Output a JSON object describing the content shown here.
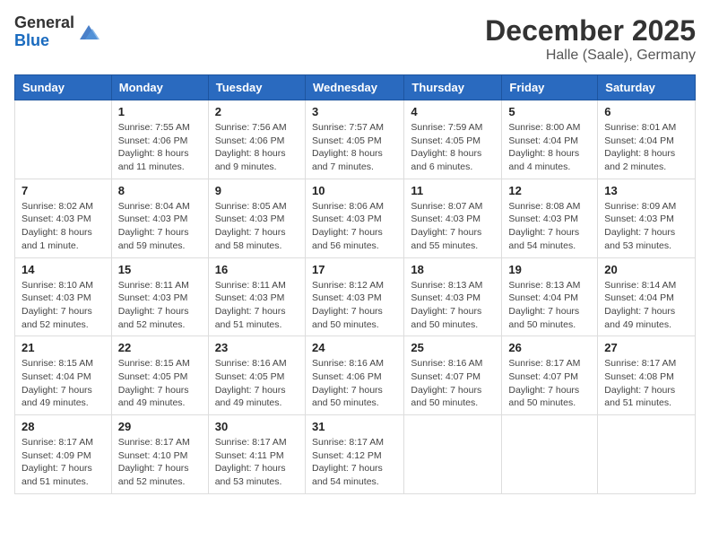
{
  "header": {
    "logo_general": "General",
    "logo_blue": "Blue",
    "month": "December 2025",
    "location": "Halle (Saale), Germany"
  },
  "columns": [
    "Sunday",
    "Monday",
    "Tuesday",
    "Wednesday",
    "Thursday",
    "Friday",
    "Saturday"
  ],
  "weeks": [
    [
      {
        "day": "",
        "sunrise": "",
        "sunset": "",
        "daylight": ""
      },
      {
        "day": "1",
        "sunrise": "7:55 AM",
        "sunset": "4:06 PM",
        "daylight": "8 hours and 11 minutes."
      },
      {
        "day": "2",
        "sunrise": "7:56 AM",
        "sunset": "4:06 PM",
        "daylight": "8 hours and 9 minutes."
      },
      {
        "day": "3",
        "sunrise": "7:57 AM",
        "sunset": "4:05 PM",
        "daylight": "8 hours and 7 minutes."
      },
      {
        "day": "4",
        "sunrise": "7:59 AM",
        "sunset": "4:05 PM",
        "daylight": "8 hours and 6 minutes."
      },
      {
        "day": "5",
        "sunrise": "8:00 AM",
        "sunset": "4:04 PM",
        "daylight": "8 hours and 4 minutes."
      },
      {
        "day": "6",
        "sunrise": "8:01 AM",
        "sunset": "4:04 PM",
        "daylight": "8 hours and 2 minutes."
      }
    ],
    [
      {
        "day": "7",
        "sunrise": "8:02 AM",
        "sunset": "4:03 PM",
        "daylight": "8 hours and 1 minute."
      },
      {
        "day": "8",
        "sunrise": "8:04 AM",
        "sunset": "4:03 PM",
        "daylight": "7 hours and 59 minutes."
      },
      {
        "day": "9",
        "sunrise": "8:05 AM",
        "sunset": "4:03 PM",
        "daylight": "7 hours and 58 minutes."
      },
      {
        "day": "10",
        "sunrise": "8:06 AM",
        "sunset": "4:03 PM",
        "daylight": "7 hours and 56 minutes."
      },
      {
        "day": "11",
        "sunrise": "8:07 AM",
        "sunset": "4:03 PM",
        "daylight": "7 hours and 55 minutes."
      },
      {
        "day": "12",
        "sunrise": "8:08 AM",
        "sunset": "4:03 PM",
        "daylight": "7 hours and 54 minutes."
      },
      {
        "day": "13",
        "sunrise": "8:09 AM",
        "sunset": "4:03 PM",
        "daylight": "7 hours and 53 minutes."
      }
    ],
    [
      {
        "day": "14",
        "sunrise": "8:10 AM",
        "sunset": "4:03 PM",
        "daylight": "7 hours and 52 minutes."
      },
      {
        "day": "15",
        "sunrise": "8:11 AM",
        "sunset": "4:03 PM",
        "daylight": "7 hours and 52 minutes."
      },
      {
        "day": "16",
        "sunrise": "8:11 AM",
        "sunset": "4:03 PM",
        "daylight": "7 hours and 51 minutes."
      },
      {
        "day": "17",
        "sunrise": "8:12 AM",
        "sunset": "4:03 PM",
        "daylight": "7 hours and 50 minutes."
      },
      {
        "day": "18",
        "sunrise": "8:13 AM",
        "sunset": "4:03 PM",
        "daylight": "7 hours and 50 minutes."
      },
      {
        "day": "19",
        "sunrise": "8:13 AM",
        "sunset": "4:04 PM",
        "daylight": "7 hours and 50 minutes."
      },
      {
        "day": "20",
        "sunrise": "8:14 AM",
        "sunset": "4:04 PM",
        "daylight": "7 hours and 49 minutes."
      }
    ],
    [
      {
        "day": "21",
        "sunrise": "8:15 AM",
        "sunset": "4:04 PM",
        "daylight": "7 hours and 49 minutes."
      },
      {
        "day": "22",
        "sunrise": "8:15 AM",
        "sunset": "4:05 PM",
        "daylight": "7 hours and 49 minutes."
      },
      {
        "day": "23",
        "sunrise": "8:16 AM",
        "sunset": "4:05 PM",
        "daylight": "7 hours and 49 minutes."
      },
      {
        "day": "24",
        "sunrise": "8:16 AM",
        "sunset": "4:06 PM",
        "daylight": "7 hours and 50 minutes."
      },
      {
        "day": "25",
        "sunrise": "8:16 AM",
        "sunset": "4:07 PM",
        "daylight": "7 hours and 50 minutes."
      },
      {
        "day": "26",
        "sunrise": "8:17 AM",
        "sunset": "4:07 PM",
        "daylight": "7 hours and 50 minutes."
      },
      {
        "day": "27",
        "sunrise": "8:17 AM",
        "sunset": "4:08 PM",
        "daylight": "7 hours and 51 minutes."
      }
    ],
    [
      {
        "day": "28",
        "sunrise": "8:17 AM",
        "sunset": "4:09 PM",
        "daylight": "7 hours and 51 minutes."
      },
      {
        "day": "29",
        "sunrise": "8:17 AM",
        "sunset": "4:10 PM",
        "daylight": "7 hours and 52 minutes."
      },
      {
        "day": "30",
        "sunrise": "8:17 AM",
        "sunset": "4:11 PM",
        "daylight": "7 hours and 53 minutes."
      },
      {
        "day": "31",
        "sunrise": "8:17 AM",
        "sunset": "4:12 PM",
        "daylight": "7 hours and 54 minutes."
      },
      {
        "day": "",
        "sunrise": "",
        "sunset": "",
        "daylight": ""
      },
      {
        "day": "",
        "sunrise": "",
        "sunset": "",
        "daylight": ""
      },
      {
        "day": "",
        "sunrise": "",
        "sunset": "",
        "daylight": ""
      }
    ]
  ]
}
